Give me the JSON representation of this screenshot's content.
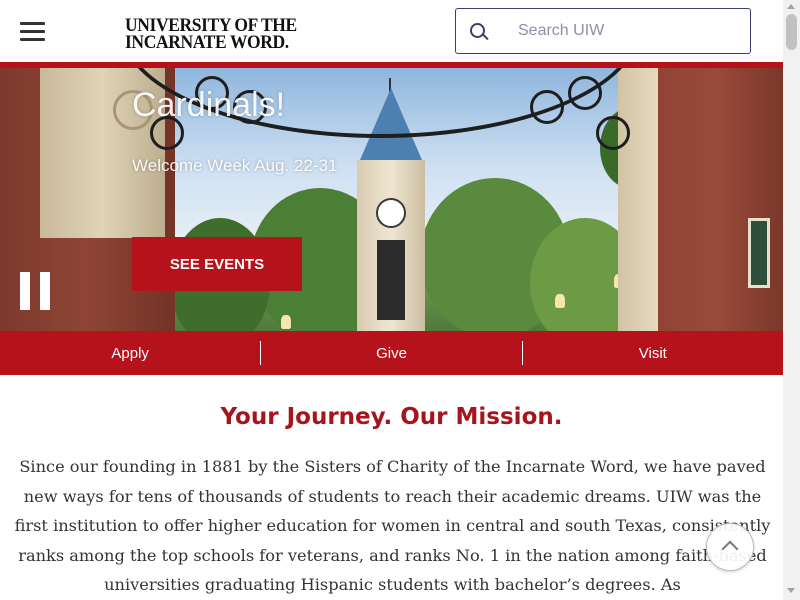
{
  "header": {
    "logo_line1": "UNIVERSITY OF THE",
    "logo_line2": "INCARNATE WORD.",
    "search_placeholder": "Search UIW"
  },
  "hero": {
    "title": "Cardinals!",
    "subtitle": "Welcome Week Aug. 22-31",
    "cta_label": "SEE EVENTS"
  },
  "actions": [
    {
      "label": "Apply"
    },
    {
      "label": "Give"
    },
    {
      "label": "Visit"
    }
  ],
  "mission": {
    "title": "Your Journey. Our Mission.",
    "body": "Since our founding in 1881 by the Sisters of Charity of the Incarnate Word, we have paved new ways for tens of thousands of students to reach their academic dreams. UIW was the first institution to offer higher education for women in central and south Texas, consistently ranks among the top schools for veterans, and ranks No. 1 in the nation among faith-based universities graduating Hispanic students with bachelor’s degrees. As"
  },
  "colors": {
    "brand_red": "#b5121b",
    "title_red": "#a6151b",
    "search_border": "#3b3f6b"
  },
  "icons": {
    "menu": "hamburger-icon",
    "search": "search-icon",
    "pause": "pause-icon",
    "back_to_top": "chevron-up-icon"
  }
}
